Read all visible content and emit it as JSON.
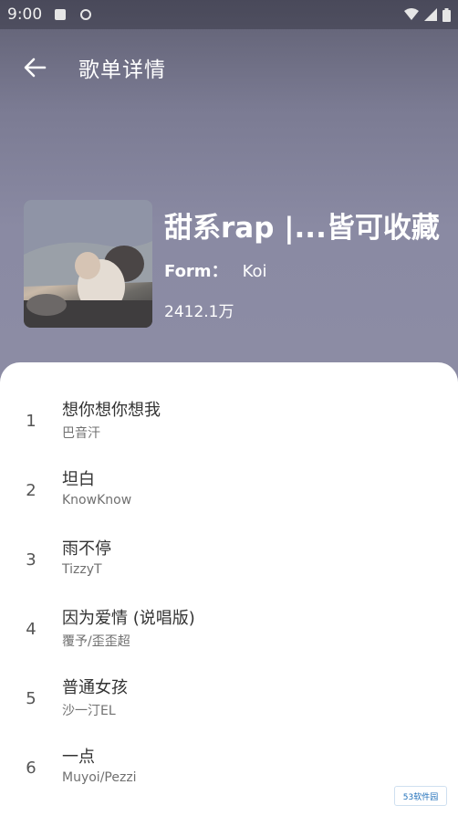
{
  "status_bar": {
    "time": "9:00"
  },
  "toolbar": {
    "title": "歌单详情"
  },
  "playlist": {
    "title": "甜系rap |...皆可收藏",
    "form_label": "Form：",
    "form_value": "Koi",
    "play_count": "2412.1万"
  },
  "songs": [
    {
      "index": "1",
      "title": "想你想你想我",
      "artist": "巴音汗"
    },
    {
      "index": "2",
      "title": "坦白",
      "artist": "KnowKnow"
    },
    {
      "index": "3",
      "title": "雨不停",
      "artist": "TizzyT"
    },
    {
      "index": "4",
      "title": "因为爱情 (说唱版)",
      "artist": "覆予/歪歪超"
    },
    {
      "index": "5",
      "title": "普通女孩",
      "artist": "沙一汀EL"
    },
    {
      "index": "6",
      "title": "一点",
      "artist": "Muyoi/Pezzi"
    }
  ],
  "watermark": {
    "text": "53软件园"
  }
}
